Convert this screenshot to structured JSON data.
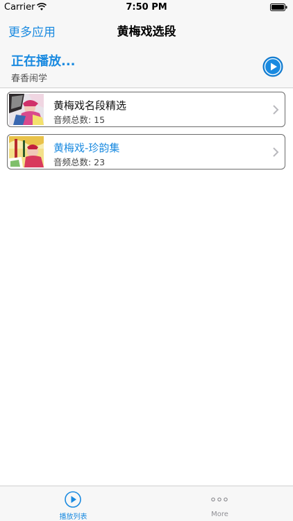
{
  "status_bar": {
    "carrier": "Carrier",
    "time": "7:50 PM"
  },
  "nav": {
    "left_button": "更多应用",
    "title": "黄梅戏选段"
  },
  "now_playing": {
    "title": "正在播放...",
    "track": "春香闹学"
  },
  "playlists": [
    {
      "title": "黄梅戏名段精选",
      "count_label": "音频总数: 15"
    },
    {
      "title": "黄梅戏-珍韵集",
      "count_label": "音频总数: 23"
    }
  ],
  "tabs": [
    {
      "label": "播放列表",
      "icon": "play-circle-icon",
      "active": true
    },
    {
      "label": "More",
      "icon": "more-dots-icon",
      "active": false
    }
  ],
  "colors": {
    "accent": "#1a8ae0",
    "bar_bg": "#f7f7f7"
  }
}
